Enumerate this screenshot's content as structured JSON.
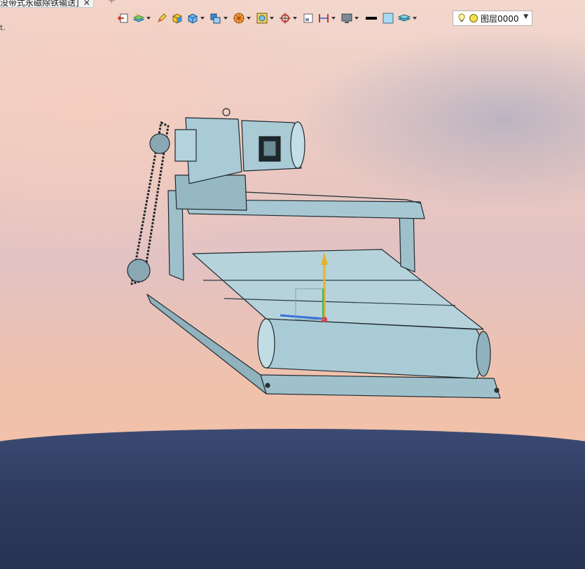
{
  "tab": {
    "title": "没带式永磁除铁输送]",
    "close_glyph": "✕",
    "new_glyph": "+"
  },
  "status": {
    "text": "t."
  },
  "toolbar": {
    "icons": [
      "exit-sketch-icon",
      "layers-icon",
      "pencil-icon",
      "box-yellow-icon",
      "box-blue-icon",
      "view-cube-icon",
      "render-mode-icon",
      "section-view-icon",
      "origin-icon",
      "sheet-icon",
      "dimension-icon",
      "monitor-icon",
      "line-color-icon",
      "fill-color-icon",
      "layer-stack-icon"
    ]
  },
  "layer": {
    "label": "图层0000",
    "dropdown_glyph": "▼"
  },
  "colors": {
    "model": "#a9cbd6",
    "model_dark": "#6f8e99",
    "outline": "#1f2a30",
    "axis_y": "#e2b42b",
    "axis_green": "#3cb44a",
    "axis_blue": "#3a6fd8",
    "axis_red": "#d84040"
  }
}
